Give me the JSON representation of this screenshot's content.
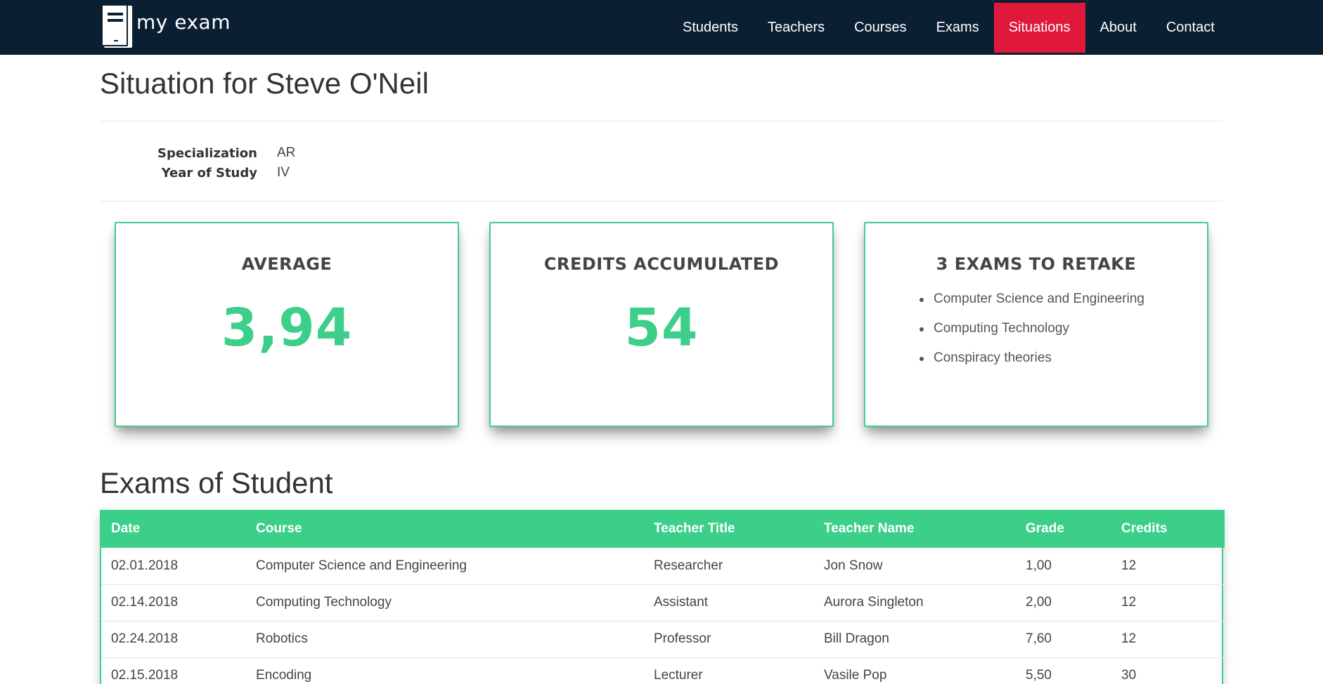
{
  "brand": {
    "name": "my exam",
    "icon": "book-icon"
  },
  "nav": {
    "items": [
      "Students",
      "Teachers",
      "Courses",
      "Exams",
      "Situations",
      "About",
      "Contact"
    ],
    "active": "Situations",
    "active_color": "#e0193a",
    "bar_color": "#0b1f33"
  },
  "page": {
    "title": "Situation for Steve O'Neil"
  },
  "student": {
    "specialization_label": "Specialization",
    "specialization": "AR",
    "year_label": "Year of Study",
    "year": "IV"
  },
  "cards": {
    "average": {
      "title": "AVERAGE",
      "value": "3,94"
    },
    "credits": {
      "title": "CREDITS ACCUMULATED",
      "value": "54"
    },
    "retake": {
      "title": "3 EXAMS TO RETAKE",
      "items": [
        "Computer Science and Engineering",
        "Computing Technology",
        "Conspiracy theories"
      ]
    },
    "accent_color": "#3ccf8a"
  },
  "exams": {
    "title": "Exams of Student",
    "columns": [
      "Date",
      "Course",
      "Teacher Title",
      "Teacher Name",
      "Grade",
      "Credits"
    ],
    "rows": [
      [
        "02.01.2018",
        "Computer Science and Engineering",
        "Researcher",
        "Jon Snow",
        "1,00",
        "12"
      ],
      [
        "02.14.2018",
        "Computing Technology",
        "Assistant",
        "Aurora Singleton",
        "2,00",
        "12"
      ],
      [
        "02.24.2018",
        "Robotics",
        "Professor",
        "Bill Dragon",
        "7,60",
        "12"
      ],
      [
        "02.15.2018",
        "Encoding",
        "Lecturer",
        "Vasile Pop",
        "5,50",
        "30"
      ]
    ]
  }
}
